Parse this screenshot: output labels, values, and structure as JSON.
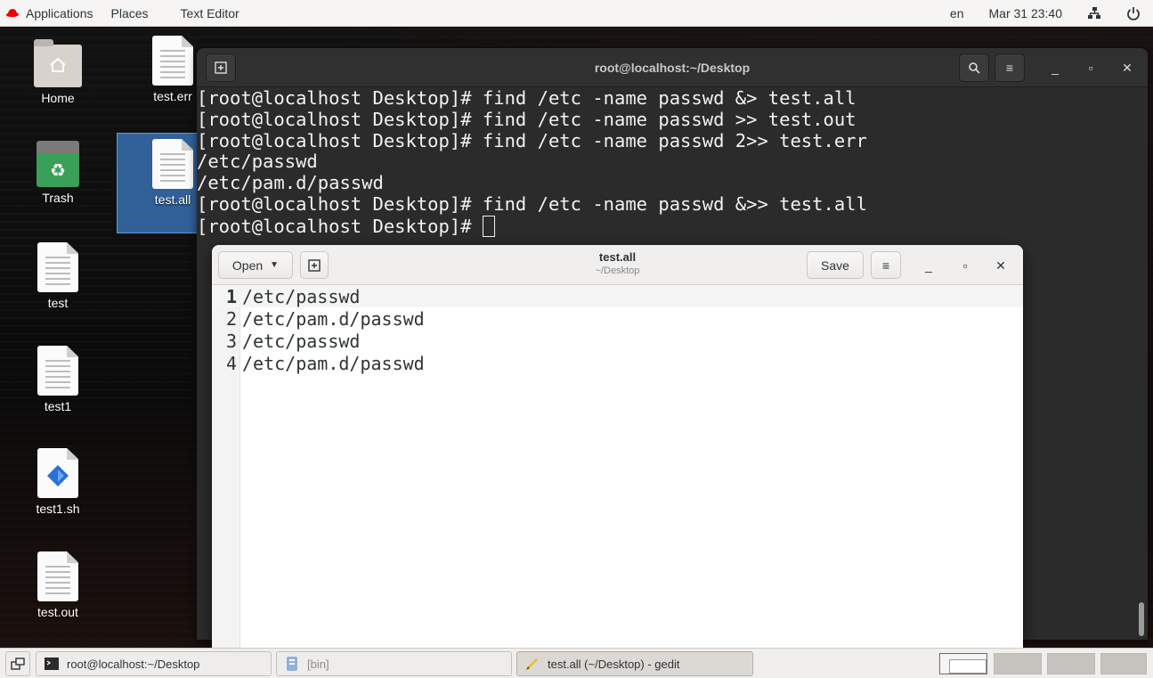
{
  "topbar": {
    "applications": "Applications",
    "places": "Places",
    "active_app": "Text Editor",
    "language": "en",
    "clock": "Mar 31 23:40",
    "icons": [
      "redhat-logo",
      "network-icon",
      "power-icon"
    ]
  },
  "desktop": {
    "icons": [
      {
        "label": "Home",
        "type": "folder"
      },
      {
        "label": "test.err",
        "type": "document"
      },
      {
        "label": "Trash",
        "type": "trash"
      },
      {
        "label": "test.all",
        "type": "document",
        "selected": true
      },
      {
        "label": "test",
        "type": "document"
      },
      {
        "label": "test1",
        "type": "document"
      },
      {
        "label": "test1.sh",
        "type": "script"
      },
      {
        "label": "test.out",
        "type": "document"
      }
    ]
  },
  "terminal": {
    "title": "root@localhost:~/Desktop",
    "lines": [
      "[root@localhost Desktop]# find /etc -name passwd &> test.all",
      "[root@localhost Desktop]# find /etc -name passwd >> test.out",
      "[root@localhost Desktop]# find /etc -name passwd 2>> test.err",
      "/etc/passwd",
      "/etc/pam.d/passwd",
      "[root@localhost Desktop]# find /etc -name passwd &>> test.all",
      "[root@localhost Desktop]# "
    ]
  },
  "gedit": {
    "open_label": "Open",
    "save_label": "Save",
    "title": "test.all",
    "subtitle": "~/Desktop",
    "lines": [
      {
        "num": "1",
        "text": "/etc/passwd"
      },
      {
        "num": "2",
        "text": "/etc/pam.d/passwd"
      },
      {
        "num": "3",
        "text": "/etc/passwd"
      },
      {
        "num": "4",
        "text": "/etc/pam.d/passwd"
      }
    ]
  },
  "taskbar": {
    "items": [
      {
        "label": "root@localhost:~/Desktop"
      },
      {
        "label": "[bin]"
      },
      {
        "label": "test.all (~/Desktop) - gedit"
      }
    ]
  },
  "colors": {
    "selection": "#3e7cc8",
    "terminal_bg": "#2b2b2b",
    "redhat_red": "#ee0000"
  }
}
